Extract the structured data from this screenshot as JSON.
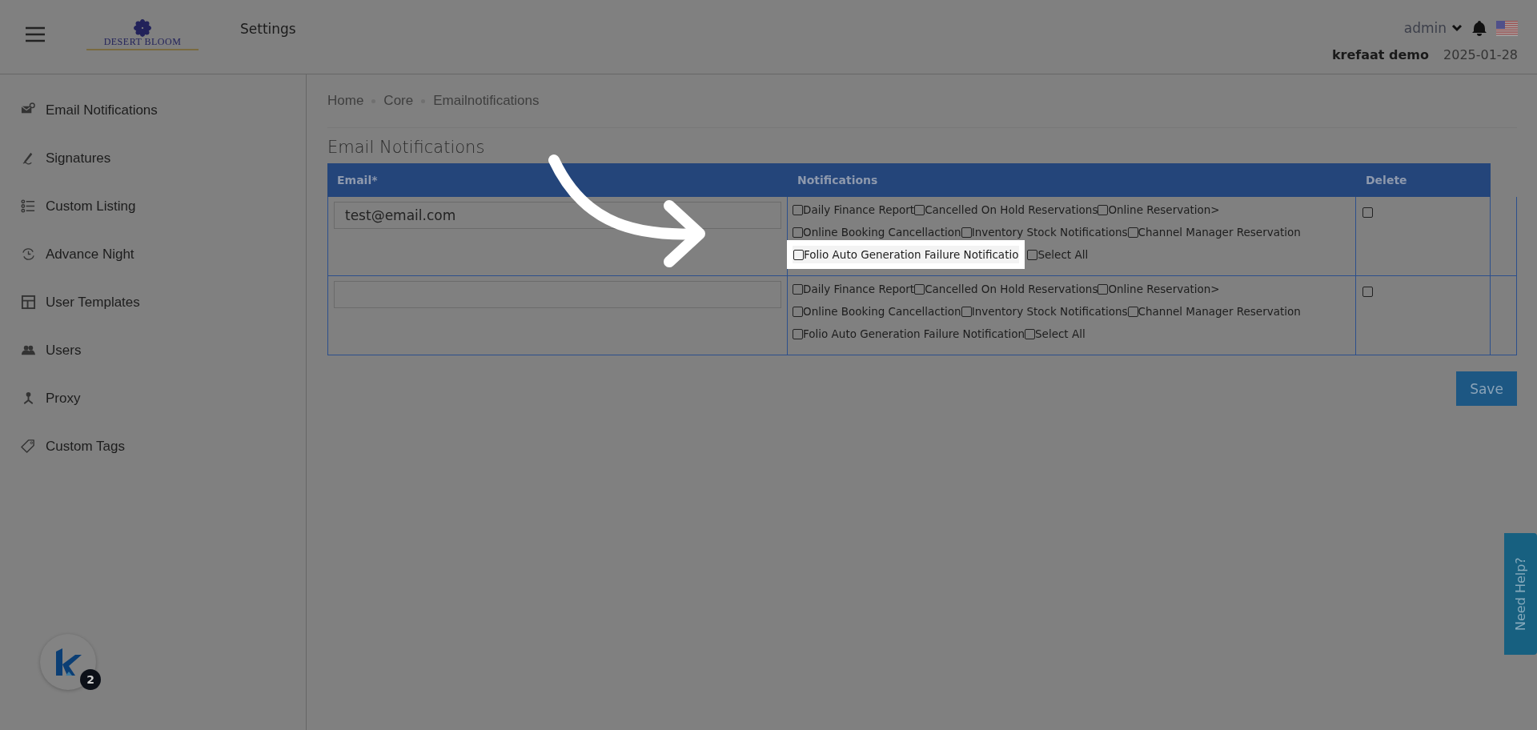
{
  "header": {
    "logo_text": "DESERT BLOOM",
    "title": "Settings",
    "user": "admin",
    "account": "krefaat demo",
    "date": "2025-01-28"
  },
  "sidebar": {
    "items": [
      {
        "label": "Email Notifications"
      },
      {
        "label": "Signatures"
      },
      {
        "label": "Custom Listing"
      },
      {
        "label": "Advance Night"
      },
      {
        "label": "User Templates"
      },
      {
        "label": "Users"
      },
      {
        "label": "Proxy"
      },
      {
        "label": "Custom Tags"
      }
    ]
  },
  "breadcrumb": [
    "Home",
    "Core",
    "Emailnotifications"
  ],
  "page_title": "Email Notifications",
  "table": {
    "columns": [
      "Email*",
      "Notifications",
      "Delete"
    ],
    "rows": [
      {
        "email": "test@email.com",
        "delete_checked": false,
        "notifications": [
          {
            "label": "Daily Finance Report",
            "checked": false,
            "highlighted": false
          },
          {
            "label": "Cancelled On Hold Reservations",
            "checked": false,
            "highlighted": false
          },
          {
            "label": "Online Reservation>",
            "checked": false,
            "highlighted": false
          },
          {
            "label": "Online Booking Cancellaction",
            "checked": false,
            "highlighted": false
          },
          {
            "label": "Inventory Stock Notifications",
            "checked": false,
            "highlighted": false
          },
          {
            "label": "Channel Manager Reservation",
            "checked": false,
            "highlighted": false
          },
          {
            "label": "Folio Auto Generation Failure Notificatio",
            "checked": false,
            "highlighted": true
          },
          {
            "label": "Select All",
            "checked": false,
            "highlighted": false
          }
        ]
      },
      {
        "delete_checked": false,
        "notifications": [
          {
            "label": "Daily Finance Report",
            "checked": false,
            "highlighted": false
          },
          {
            "label": "Cancelled On Hold Reservations",
            "checked": false,
            "highlighted": false
          },
          {
            "label": "Online Reservation>",
            "checked": false,
            "highlighted": false
          },
          {
            "label": "Online Booking Cancellaction",
            "checked": false,
            "highlighted": false
          },
          {
            "label": "Inventory Stock Notifications",
            "checked": false,
            "highlighted": false
          },
          {
            "label": "Channel Manager Reservation",
            "checked": false,
            "highlighted": false
          },
          {
            "label": "Folio Auto Generation Failure Notification",
            "checked": false,
            "highlighted": false
          },
          {
            "label": "Select All",
            "checked": false,
            "highlighted": false
          }
        ]
      }
    ]
  },
  "save_button": "Save",
  "help_tab": "Need Help?",
  "assistant_badge": {
    "count": "2"
  }
}
